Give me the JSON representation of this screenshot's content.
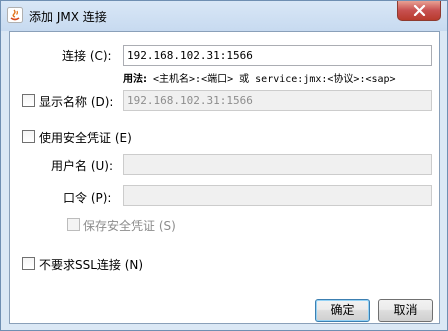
{
  "window": {
    "title": "添加 JMX 连接",
    "app_icon": "java-icon",
    "close_icon": "close-icon"
  },
  "form": {
    "connection_label": "连接 (C):",
    "connection_value": "192.168.102.31:1566",
    "usage_bold": "用法:",
    "usage_text": " <主机名>:<端口> 或 service:jmx:<协议>:<sap>",
    "display_name_label": "显示名称 (D):",
    "display_name_checked": false,
    "display_name_value": "192.168.102.31:1566",
    "use_credentials_label": "使用安全凭证 (E)",
    "use_credentials_checked": false,
    "username_label": "用户名 (U):",
    "username_value": "",
    "password_label": "口令 (P):",
    "password_value": "",
    "save_credentials_label": "保存安全凭证 (S)",
    "save_credentials_checked": false,
    "no_ssl_label": "不要求SSL连接 (N)",
    "no_ssl_checked": false
  },
  "buttons": {
    "ok": "确定",
    "cancel": "取消"
  }
}
